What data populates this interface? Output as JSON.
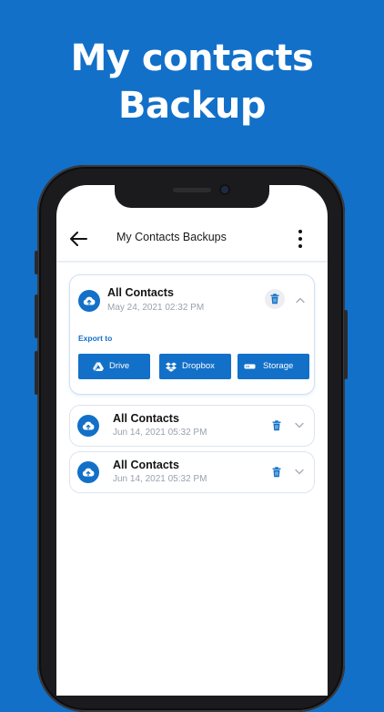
{
  "headline": {
    "line1": "My contacts",
    "line2": "Backup"
  },
  "appbar": {
    "title": "My Contacts Backups",
    "back_icon": "arrow-left-icon",
    "menu_icon": "more-vertical-icon"
  },
  "backups": [
    {
      "title": "All Contacts",
      "date": "May 24, 2021 02:32 PM",
      "expanded": true,
      "export_label": "Export to",
      "export_options": [
        "Drive",
        "Dropbox",
        "Storage"
      ]
    },
    {
      "title": "All Contacts",
      "date": "Jun 14, 2021 05:32 PM",
      "expanded": false
    },
    {
      "title": "All Contacts",
      "date": "Jun 14, 2021 05:32 PM",
      "expanded": false
    }
  ],
  "colors": {
    "brand": "#1270c8",
    "background": "#1270c8",
    "card_border": "#dde4ee",
    "date_text": "#9aa1ab"
  }
}
